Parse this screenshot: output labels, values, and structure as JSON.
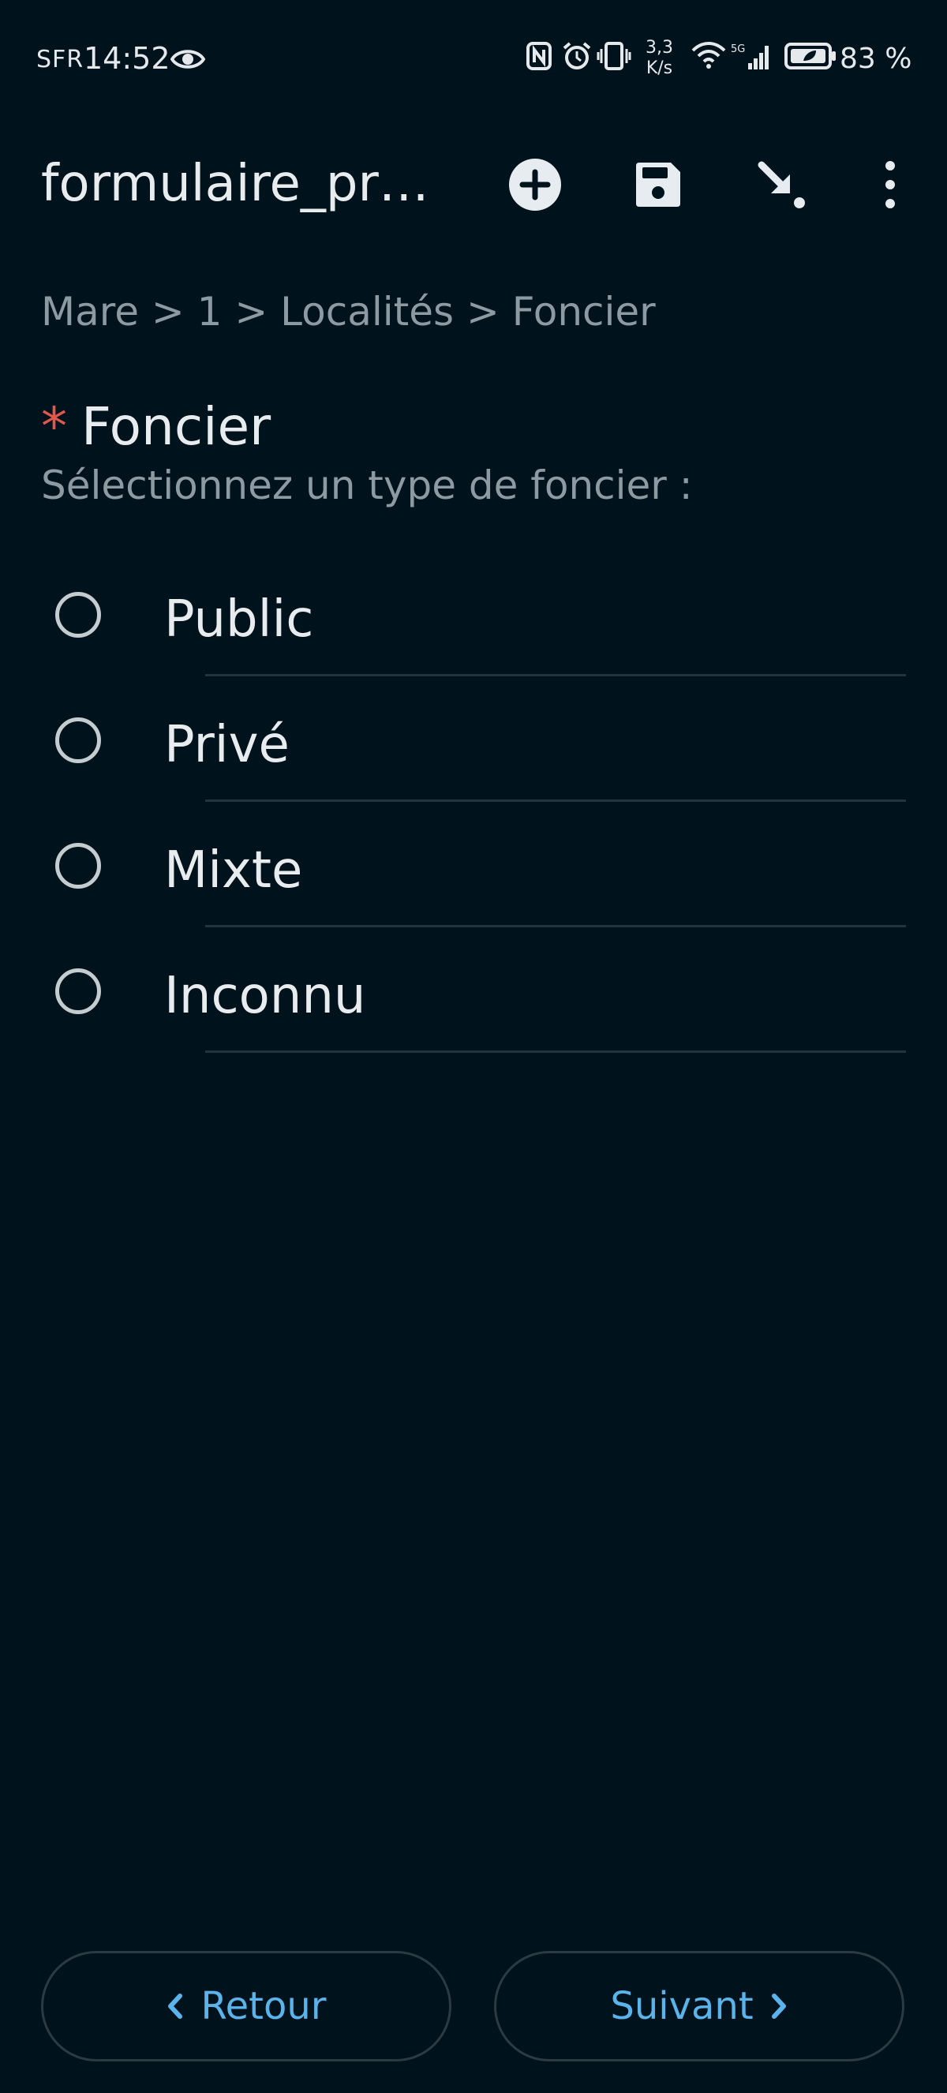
{
  "status_bar": {
    "carrier": "SFR",
    "time": "14:52",
    "net_speed_value": "3,3",
    "net_speed_unit": "K/s",
    "battery": "83 %",
    "icons": [
      "eye-icon",
      "nfc-icon",
      "alarm-icon",
      "vibrate-icon",
      "wifi-icon",
      "signal-5g-icon",
      "battery-icon"
    ]
  },
  "app_bar": {
    "title": "formulaire_pra...",
    "actions": [
      "add-circle-icon",
      "save-icon",
      "send-icon",
      "more-vert-icon"
    ]
  },
  "breadcrumb": "Mare > 1 > Localités > Foncier",
  "question": {
    "required_marker": "*",
    "label": "Foncier",
    "hint": "Sélectionnez un type de foncier :",
    "options": [
      {
        "label": "Public",
        "selected": false
      },
      {
        "label": "Privé",
        "selected": false
      },
      {
        "label": "Mixte",
        "selected": false
      },
      {
        "label": "Inconnu",
        "selected": false
      }
    ]
  },
  "navigation": {
    "back_label": "Retour",
    "next_label": "Suivant"
  },
  "colors": {
    "background": "#00121b",
    "accent": "#5ab3ea",
    "required": "#e2574c",
    "secondary_text": "#8e9aa1"
  }
}
